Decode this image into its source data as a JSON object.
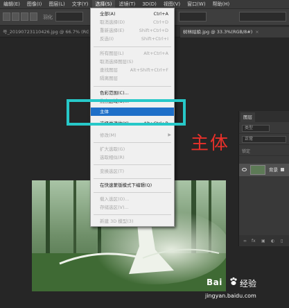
{
  "menubar": {
    "items": [
      "编辑(E)",
      "图像(I)",
      "图层(L)",
      "文字(Y)",
      "选择(S)",
      "滤镜(T)",
      "3D(D)",
      "视图(V)",
      "窗口(W)",
      "帮助(H)"
    ]
  },
  "options": {
    "feather_label": "羽化",
    "width_label": "宽度",
    "select_mask_label": "选择并遮住..."
  },
  "tabs": [
    {
      "label": "号_20190723110426.jpg @ 66.7% (RGB/8#)",
      "close": "×"
    },
    {
      "label": "树林姑娘.jpg @ 33.3%(RGB/8#)",
      "close": "×"
    }
  ],
  "select_menu": {
    "items": [
      {
        "label": "全部(A)",
        "shortcut": "Ctrl+A",
        "disabled": false
      },
      {
        "label": "取消选择(D)",
        "shortcut": "Ctrl+D",
        "disabled": true
      },
      {
        "label": "重新选择(E)",
        "shortcut": "Shift+Ctrl+D",
        "disabled": true
      },
      {
        "label": "反选(I)",
        "shortcut": "Shift+Ctrl+I",
        "disabled": true
      },
      {
        "label": "所有图层(L)",
        "shortcut": "Alt+Ctrl+A",
        "disabled": true
      },
      {
        "label": "取消选择图层(S)",
        "shortcut": "",
        "disabled": true
      },
      {
        "label": "查找图层",
        "shortcut": "Alt+Shift+Ctrl+F",
        "disabled": true
      },
      {
        "label": "隔离图层",
        "shortcut": "",
        "disabled": true
      },
      {
        "label": "色彩范围(C)...",
        "shortcut": "",
        "disabled": false
      },
      {
        "label": "焦点区域(U)...",
        "shortcut": "",
        "disabled": false
      },
      {
        "label": "主体",
        "shortcut": "",
        "disabled": false,
        "highlighted": true
      },
      {
        "label": "选择并遮住(K)...",
        "shortcut": "Alt+Ctrl+R",
        "disabled": false
      },
      {
        "label": "修改(M)",
        "shortcut": "",
        "disabled": true,
        "submenu": true
      },
      {
        "label": "扩大选取(G)",
        "shortcut": "",
        "disabled": true
      },
      {
        "label": "选取相似(R)",
        "shortcut": "",
        "disabled": true
      },
      {
        "label": "变换选区(T)",
        "shortcut": "",
        "disabled": true
      },
      {
        "label": "在快速蒙版模式下编辑(Q)",
        "shortcut": "",
        "disabled": false
      },
      {
        "label": "载入选区(O)...",
        "shortcut": "",
        "disabled": true
      },
      {
        "label": "存储选区(V)...",
        "shortcut": "",
        "disabled": true
      },
      {
        "label": "新建 3D 模型(3)",
        "shortcut": "",
        "disabled": true
      }
    ]
  },
  "annotation": {
    "text": "主体"
  },
  "layers_panel": {
    "tab": "图层",
    "search_placeholder": "类型",
    "blend_mode": "正常",
    "lock_label": "锁定",
    "layer_name": "背景",
    "footer_fx": "fx"
  },
  "watermark": {
    "logo": "Bai",
    "cn": "经验",
    "url": "jingyan.baidu.com"
  },
  "colors": {
    "menu_highlight": "#1e6fc8",
    "annotation_box": "#27c8c8",
    "annotation_text": "#e8302a"
  }
}
